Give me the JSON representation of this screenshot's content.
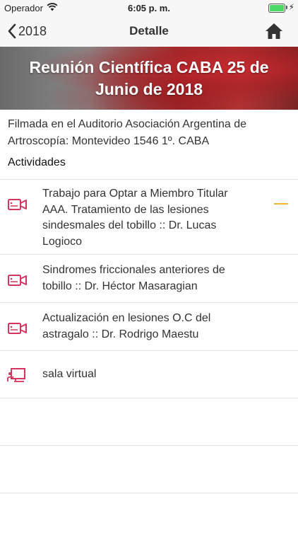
{
  "status_bar": {
    "carrier": "Operador",
    "time": "6:05 p. m.",
    "battery_level": 1.0,
    "battery_color": "#4cd964"
  },
  "nav": {
    "back_label": "2018",
    "title": "Detalle",
    "home_icon": "home-icon"
  },
  "hero": {
    "title": "Reunión Científica CABA 25 de Junio de 2018"
  },
  "location": "Filmada en el Auditorio Asociación Argentina de Artroscopía: Montevideo 1546 1º. CABA",
  "section_label": "Actividades",
  "activities": [
    {
      "text": "Trabajo para Optar a Miembro Titular AAA. Tratamiento de las lesiones sindesmales del tobillo :: Dr. Lucas Logioco",
      "icon": "video-camera-icon"
    },
    {
      "text": "Sindromes friccionales anteriores de tobillo :: Dr. Héctor Masaragian",
      "icon": "video-camera-icon"
    },
    {
      "text": "Actualización en lesiones O.C del astragalo :: Dr. Rodrigo Maestu",
      "icon": "video-camera-icon"
    },
    {
      "text": "sala virtual",
      "icon": "presentation-icon"
    }
  ],
  "colors": {
    "accent": "#d2355e",
    "highlight": "#e8b93a"
  }
}
